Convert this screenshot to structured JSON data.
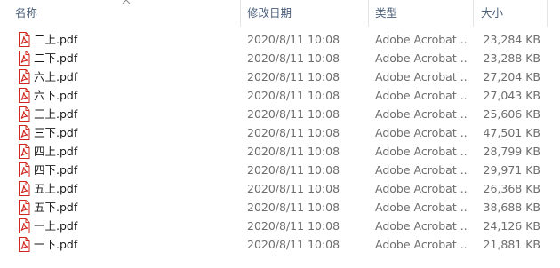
{
  "columns": {
    "name": "名称",
    "date": "修改日期",
    "type": "类型",
    "size": "大小"
  },
  "files": [
    {
      "name": "二上.pdf",
      "date": "2020/8/11 10:08",
      "type": "Adobe Acrobat ...",
      "size": "23,284 KB",
      "icon": "pdf-icon"
    },
    {
      "name": "二下.pdf",
      "date": "2020/8/11 10:08",
      "type": "Adobe Acrobat ...",
      "size": "23,288 KB",
      "icon": "pdf-icon"
    },
    {
      "name": "六上.pdf",
      "date": "2020/8/11 10:08",
      "type": "Adobe Acrobat ...",
      "size": "27,204 KB",
      "icon": "pdf-icon"
    },
    {
      "name": "六下.pdf",
      "date": "2020/8/11 10:08",
      "type": "Adobe Acrobat ...",
      "size": "27,043 KB",
      "icon": "pdf-icon"
    },
    {
      "name": "三上.pdf",
      "date": "2020/8/11 10:08",
      "type": "Adobe Acrobat ...",
      "size": "25,606 KB",
      "icon": "pdf-icon"
    },
    {
      "name": "三下.pdf",
      "date": "2020/8/11 10:08",
      "type": "Adobe Acrobat ...",
      "size": "47,501 KB",
      "icon": "pdf-icon"
    },
    {
      "name": "四上.pdf",
      "date": "2020/8/11 10:08",
      "type": "Adobe Acrobat ...",
      "size": "28,799 KB",
      "icon": "pdf-icon"
    },
    {
      "name": "四下.pdf",
      "date": "2020/8/11 10:08",
      "type": "Adobe Acrobat ...",
      "size": "29,971 KB",
      "icon": "pdf-icon"
    },
    {
      "name": "五上.pdf",
      "date": "2020/8/11 10:08",
      "type": "Adobe Acrobat ...",
      "size": "26,368 KB",
      "icon": "pdf-icon"
    },
    {
      "name": "五下.pdf",
      "date": "2020/8/11 10:08",
      "type": "Adobe Acrobat ...",
      "size": "38,688 KB",
      "icon": "pdf-icon"
    },
    {
      "name": "一上.pdf",
      "date": "2020/8/11 10:08",
      "type": "Adobe Acrobat ...",
      "size": "24,126 KB",
      "icon": "pdf-icon"
    },
    {
      "name": "一下.pdf",
      "date": "2020/8/11 10:08",
      "type": "Adobe Acrobat ...",
      "size": "21,881 KB",
      "icon": "pdf-icon"
    }
  ],
  "colors": {
    "header_text": "#4c607a",
    "secondary_text": "#6d6d6d",
    "pdf_red": "#d0261d"
  }
}
